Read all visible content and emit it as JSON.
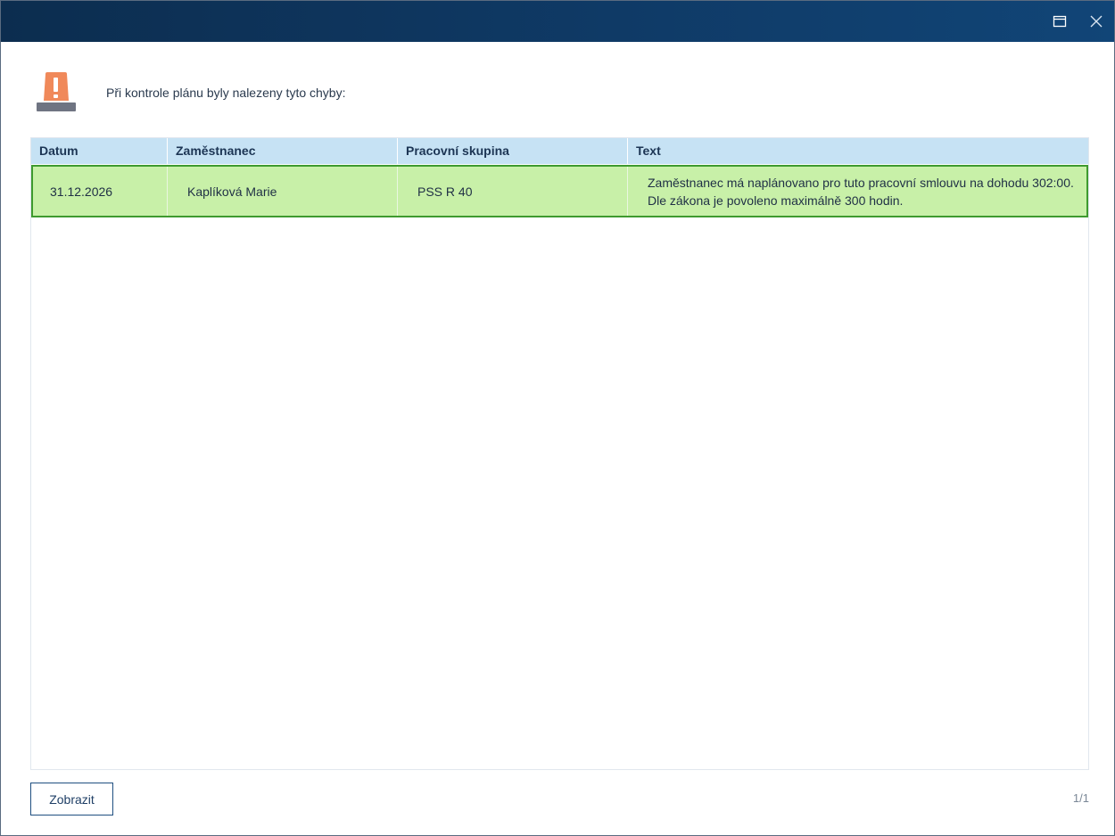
{
  "window": {
    "icons": {
      "maximize": "window-restore-icon",
      "close": "close-icon"
    }
  },
  "message": {
    "icon": "alert-beacon-icon",
    "text": "Při kontrole plánu byly nalezeny tyto chyby:"
  },
  "table": {
    "columns": [
      "Datum",
      "Zaměstnanec",
      "Pracovní skupina",
      "Text"
    ],
    "rows": [
      {
        "date": "31.12.2026",
        "employee": "Kaplíková Marie",
        "group": "PSS R 40",
        "text": "Zaměstnanec má naplánovano pro tuto pracovní smlouvu na dohodu 302:00. Dle zákona je povoleno maximálně 300 hodin."
      }
    ]
  },
  "footer": {
    "show_button": "Zobrazit",
    "pager": "1/1"
  },
  "colors": {
    "titlebar": "#0f3a66",
    "header": "#c6e2f4",
    "selected_row": "#c8f0a8",
    "selected_border": "#3e9a2f",
    "alert": "#f0895a"
  }
}
